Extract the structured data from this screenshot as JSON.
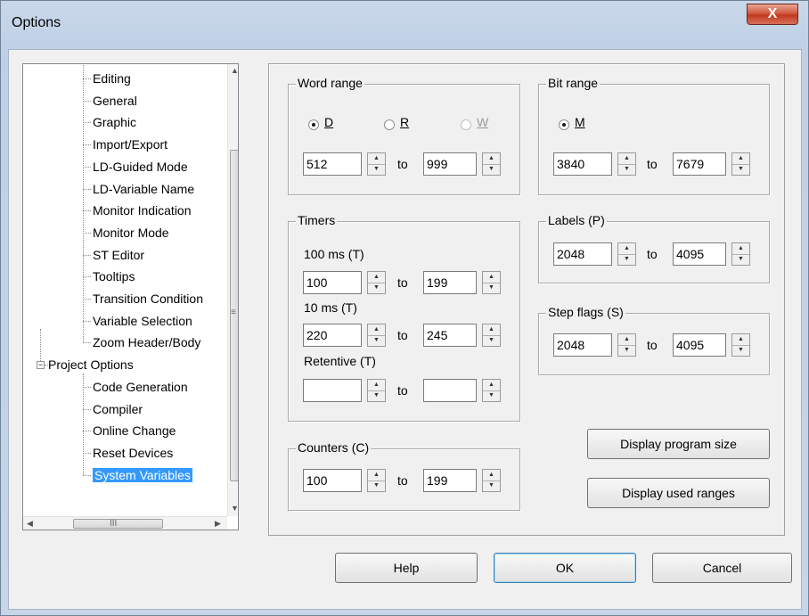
{
  "window": {
    "title": "Options",
    "close_glyph": "X"
  },
  "tree": {
    "items": [
      {
        "label": "Editing"
      },
      {
        "label": "General"
      },
      {
        "label": "Graphic"
      },
      {
        "label": "Import/Export"
      },
      {
        "label": "LD-Guided Mode"
      },
      {
        "label": "LD-Variable Name"
      },
      {
        "label": "Monitor Indication"
      },
      {
        "label": "Monitor Mode"
      },
      {
        "label": "ST Editor"
      },
      {
        "label": "Tooltips"
      },
      {
        "label": "Transition Condition"
      },
      {
        "label": "Variable Selection"
      },
      {
        "label": "Zoom Header/Body"
      },
      {
        "label": "Project Options",
        "expander": "−"
      },
      {
        "label": "Code Generation"
      },
      {
        "label": "Compiler"
      },
      {
        "label": "Online Change"
      },
      {
        "label": "Reset Devices"
      },
      {
        "label": "System Variables",
        "selected": true
      }
    ],
    "hscroll_grip": "III",
    "vscroll_grip": "≡"
  },
  "word_range": {
    "legend": "Word range",
    "options": [
      {
        "label": "D",
        "checked": true,
        "enabled": true
      },
      {
        "label": "R",
        "checked": false,
        "enabled": true
      },
      {
        "label": "W",
        "checked": false,
        "enabled": false
      }
    ],
    "from": "512",
    "to_label": "to",
    "to": "999"
  },
  "bit_range": {
    "legend": "Bit range",
    "options": [
      {
        "label": "M",
        "checked": true
      }
    ],
    "from": "3840",
    "to_label": "to",
    "to": "7679"
  },
  "timers": {
    "legend": "Timers",
    "rows": [
      {
        "label": "100 ms (T)",
        "from": "100",
        "to_label": "to",
        "to": "199"
      },
      {
        "label": "10 ms (T)",
        "from": "220",
        "to_label": "to",
        "to": "245"
      },
      {
        "label": "Retentive (T)",
        "from": "",
        "to_label": "to",
        "to": ""
      }
    ]
  },
  "labels": {
    "legend": "Labels (P)",
    "from": "2048",
    "to_label": "to",
    "to": "4095"
  },
  "step_flags": {
    "legend": "Step flags (S)",
    "from": "2048",
    "to_label": "to",
    "to": "4095"
  },
  "counters": {
    "legend": "Counters (C)",
    "from": "100",
    "to_label": "to",
    "to": "199"
  },
  "actions": {
    "display_program_size": "Display program size",
    "display_used_ranges": "Display used ranges"
  },
  "footer": {
    "help": "Help",
    "ok": "OK",
    "cancel": "Cancel"
  },
  "icons": {
    "spin_up": "▲",
    "spin_down": "▼",
    "scroll_up": "▲",
    "scroll_down": "▼",
    "scroll_left": "◀",
    "scroll_right": "▶"
  }
}
